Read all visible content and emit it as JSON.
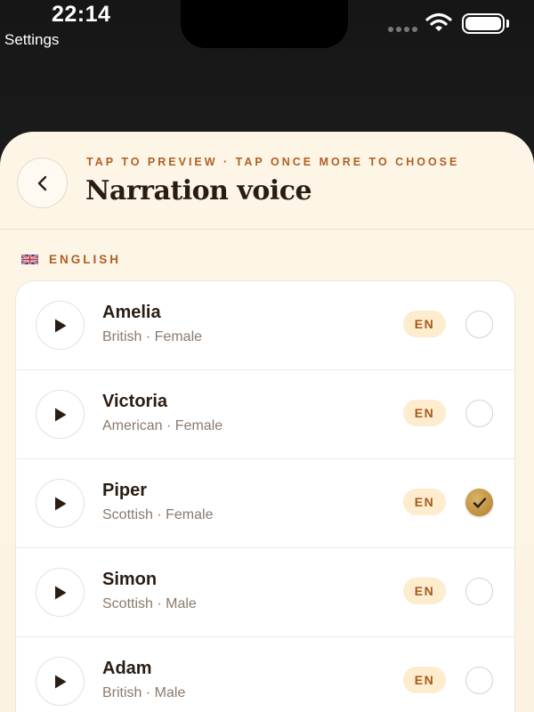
{
  "status_bar": {
    "time": "22:14",
    "back_app": "Settings"
  },
  "header": {
    "eyebrow": "TAP TO PREVIEW · TAP ONCE MORE TO CHOOSE",
    "title": "Narration voice",
    "back_icon": "chevron-left-icon"
  },
  "section": {
    "flag_icon": "uk-flag-icon",
    "label": "ENGLISH"
  },
  "colors": {
    "accent": "#b05f24",
    "selected": "#c49645",
    "badge_bg": "#fdeccd"
  },
  "voices": [
    {
      "name": "Amelia",
      "meta": "British · Female",
      "lang": "EN",
      "selected": false
    },
    {
      "name": "Victoria",
      "meta": "American · Female",
      "lang": "EN",
      "selected": false
    },
    {
      "name": "Piper",
      "meta": "Scottish · Female",
      "lang": "EN",
      "selected": true
    },
    {
      "name": "Simon",
      "meta": "Scottish · Male",
      "lang": "EN",
      "selected": false
    },
    {
      "name": "Adam",
      "meta": "British · Male",
      "lang": "EN",
      "selected": false
    }
  ]
}
